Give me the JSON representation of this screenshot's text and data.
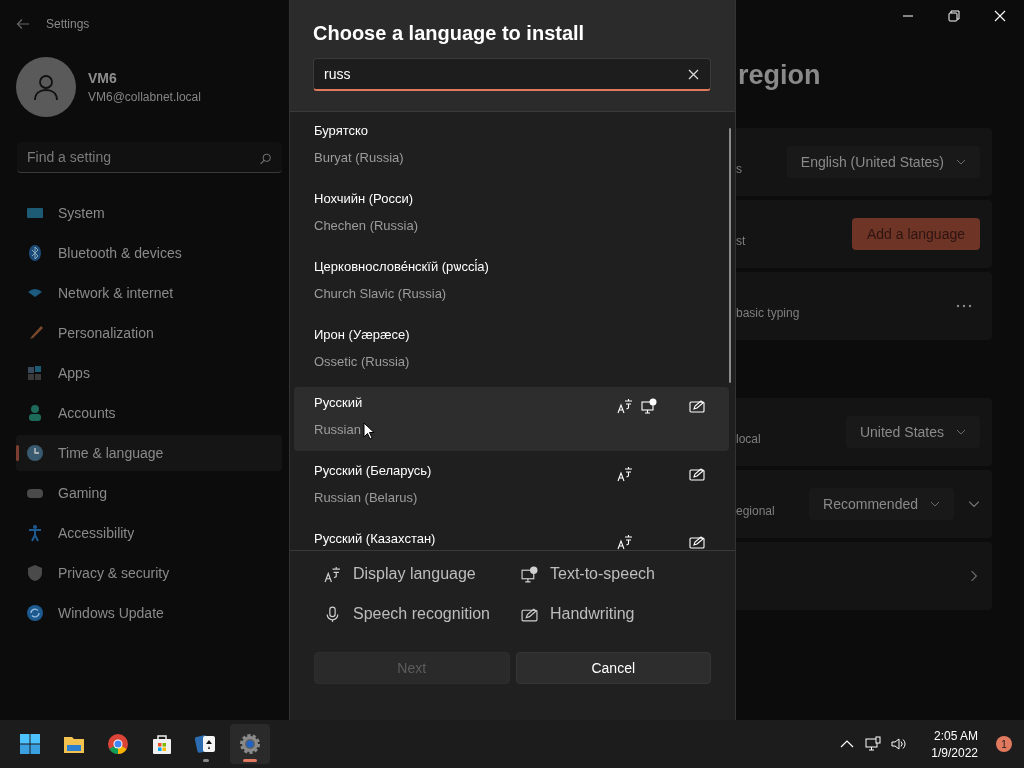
{
  "settings": {
    "title": "Settings",
    "user": {
      "name": "VM6",
      "email": "VM6@collabnet.local"
    },
    "search": {
      "placeholder": "Find a setting"
    },
    "nav": [
      {
        "label": "System",
        "selected": false
      },
      {
        "label": "Bluetooth & devices",
        "selected": false
      },
      {
        "label": "Network & internet",
        "selected": false
      },
      {
        "label": "Personalization",
        "selected": false
      },
      {
        "label": "Apps",
        "selected": false
      },
      {
        "label": "Accounts",
        "selected": false
      },
      {
        "label": "Time & language",
        "selected": true
      },
      {
        "label": "Gaming",
        "selected": false
      },
      {
        "label": "Accessibility",
        "selected": false
      },
      {
        "label": "Privacy & security",
        "selected": false
      },
      {
        "label": "Windows Update",
        "selected": false
      }
    ],
    "page_title": "region",
    "card_groups": [
      [
        {
          "kind": "dropdown",
          "label": "s",
          "value": "English (United States)"
        },
        {
          "kind": "button",
          "label": "st",
          "button": "Add a language"
        },
        {
          "kind": "more",
          "label": "basic typing"
        }
      ],
      [
        {
          "kind": "dropdown",
          "label": "local",
          "value": "United States"
        },
        {
          "kind": "dropdown_expand",
          "label": "egional",
          "value": "Recommended"
        },
        {
          "kind": "link"
        }
      ]
    ]
  },
  "dialog": {
    "title": "Choose a language to install",
    "search": {
      "value": "russ"
    },
    "languages": [
      {
        "native": "Бурятско",
        "english": "Buryat (Russia)",
        "selected": false,
        "features": {
          "display_language": false,
          "text_to_speech": false,
          "speech_recognition": false,
          "handwriting": false
        }
      },
      {
        "native": "Нохчийн (Росси)",
        "english": "Chechen (Russia)",
        "selected": false,
        "features": {
          "display_language": false,
          "text_to_speech": false,
          "speech_recognition": false,
          "handwriting": false
        }
      },
      {
        "native": "Церковнослове́нскїй (рѡссі́а)",
        "english": "Church Slavic (Russia)",
        "selected": false,
        "features": {
          "display_language": false,
          "text_to_speech": false,
          "speech_recognition": false,
          "handwriting": false
        }
      },
      {
        "native": "Ирон (Уæрæсе)",
        "english": "Ossetic (Russia)",
        "selected": false,
        "features": {
          "display_language": false,
          "text_to_speech": false,
          "speech_recognition": false,
          "handwriting": false
        }
      },
      {
        "native": "Русский",
        "english": "Russian",
        "selected": true,
        "features": {
          "display_language": true,
          "text_to_speech": true,
          "speech_recognition": false,
          "handwriting": true
        }
      },
      {
        "native": "Русский (Беларусь)",
        "english": "Russian (Belarus)",
        "selected": false,
        "features": {
          "display_language": true,
          "text_to_speech": false,
          "speech_recognition": false,
          "handwriting": true
        }
      },
      {
        "native": "Русский (Казахстан)",
        "selected": false,
        "features": {
          "display_language": true,
          "text_to_speech": false,
          "speech_recognition": false,
          "handwriting": true
        }
      }
    ],
    "legend": [
      {
        "kind": "display_language",
        "label": "Display language"
      },
      {
        "kind": "text_to_speech",
        "label": "Text-to-speech"
      },
      {
        "kind": "speech_recognition",
        "label": "Speech recognition"
      },
      {
        "kind": "handwriting",
        "label": "Handwriting"
      }
    ],
    "buttons": [
      {
        "label": "Next",
        "disabled": true
      },
      {
        "label": "Cancel",
        "disabled": false
      }
    ]
  },
  "taskbar": {
    "apps": [
      {
        "kind": "start",
        "running": false,
        "active": false
      },
      {
        "kind": "explorer",
        "running": false,
        "active": false
      },
      {
        "kind": "chrome",
        "running": false,
        "active": false
      },
      {
        "kind": "store",
        "running": false,
        "active": false
      },
      {
        "kind": "solitaire",
        "running": true,
        "active": false
      },
      {
        "kind": "settings",
        "running": true,
        "active": true
      }
    ],
    "time": "2:05 AM",
    "date": "1/9/2022",
    "notifications": "1"
  }
}
